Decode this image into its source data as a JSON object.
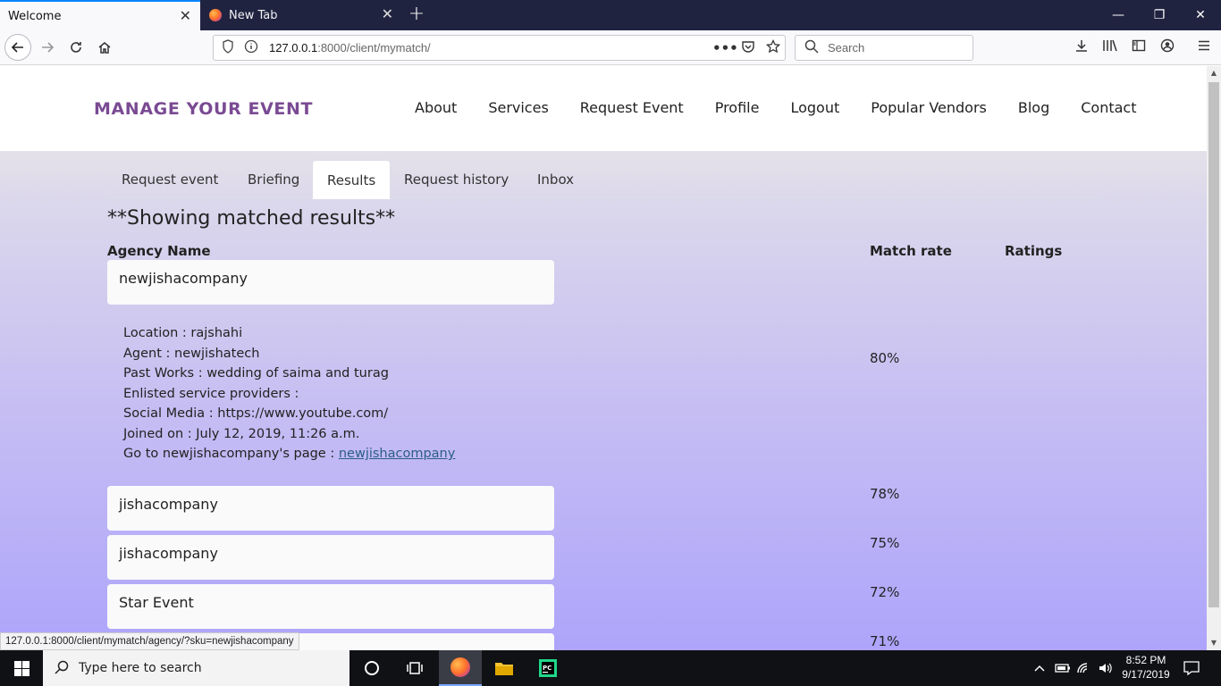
{
  "browser": {
    "tabs": [
      {
        "title": "Welcome",
        "active": true
      },
      {
        "title": "New Tab",
        "active": false
      }
    ],
    "url_host": "127.0.0.1",
    "url_rest": ":8000/client/mymatch/",
    "search_placeholder": "Search",
    "status_url": "127.0.0.1:8000/client/mymatch/agency/?sku=newjishacompany"
  },
  "site": {
    "brand": "MANAGE YOUR EVENT",
    "nav": [
      "About",
      "Services",
      "Request Event",
      "Profile",
      "Logout",
      "Popular Vendors",
      "Blog",
      "Contact"
    ]
  },
  "subtabs": [
    "Request event",
    "Briefing",
    "Results",
    "Request history",
    "Inbox"
  ],
  "active_subtab": "Results",
  "heading": "**Showing matched results**",
  "columns": {
    "name": "Agency Name",
    "match": "Match rate",
    "ratings": "Ratings"
  },
  "results": [
    {
      "name": "newjishacompany",
      "rate": "80%"
    },
    {
      "name": "jishacompany",
      "rate": "78%"
    },
    {
      "name": "jishacompany",
      "rate": "75%"
    },
    {
      "name": "Star Event",
      "rate": "72%"
    },
    {
      "name": "",
      "rate": "71%"
    }
  ],
  "details": {
    "location": "Location : rajshahi",
    "agent": "Agent : newjishatech",
    "past_works": "Past Works : wedding of saima and turag",
    "enlisted": "Enlisted service providers :",
    "social": "Social Media : https://www.youtube.com/",
    "joined": "Joined on : July 12, 2019, 11:26 a.m.",
    "goto_prefix": "Go to newjishacompany's page : ",
    "goto_link": "newjishacompany"
  },
  "taskbar": {
    "search_placeholder": "Type here to search",
    "time": "8:52 PM",
    "date": "9/17/2019"
  }
}
